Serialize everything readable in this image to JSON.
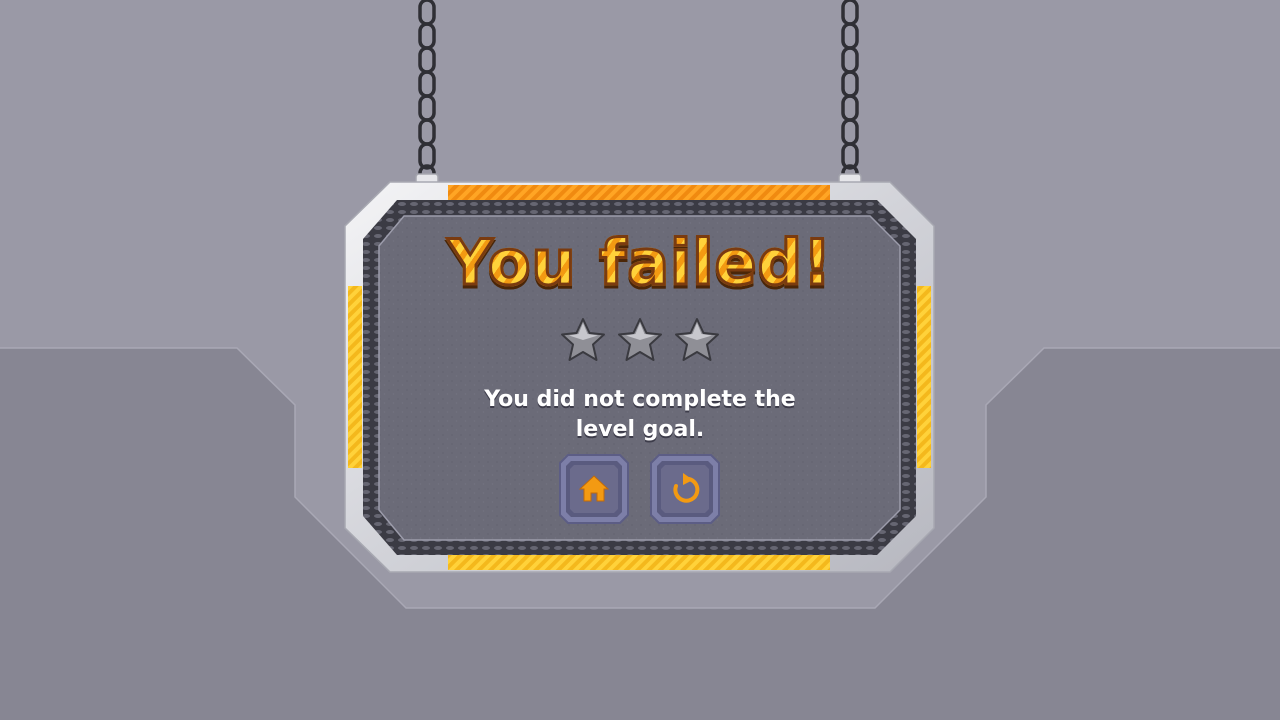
{
  "screen": {
    "title": "You failed!",
    "message": "You did not complete the level goal.",
    "stars_earned": 0,
    "stars_total": 3
  },
  "buttons": {
    "home": {
      "icon": "home-icon"
    },
    "restart": {
      "icon": "restart-icon"
    }
  },
  "colors": {
    "background": "#9a99a6",
    "floor": "#878693",
    "board": "#6b6b78",
    "title_gradient_light": "#ffd23a",
    "title_gradient_dark": "#f39a12",
    "accent_orange": "#f08a10",
    "accent_yellow": "#f6c020",
    "button_face": "#7d7fa8",
    "icon_color": "#f39a12"
  }
}
